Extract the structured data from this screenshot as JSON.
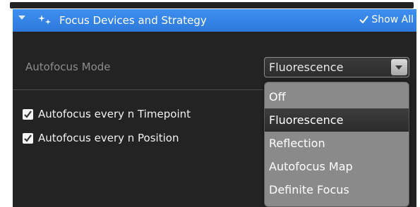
{
  "panel": {
    "title": "Focus Devices and Strategy",
    "show_all_label": "Show All",
    "icons": [
      "collapse-chevron-icon",
      "focus-sparkle-icon",
      "checkmark-icon"
    ],
    "accent_color": "#3886ea"
  },
  "autofocus_mode": {
    "label": "Autofocus Mode",
    "selected": "Fluorescence",
    "options": [
      "Off",
      "Fluorescence",
      "Reflection",
      "Autofocus Map",
      "Definite Focus"
    ]
  },
  "checkboxes": [
    {
      "label": "Autofocus every n Timepoint",
      "checked": true
    },
    {
      "label": "Autofocus every n Position",
      "checked": true
    }
  ]
}
